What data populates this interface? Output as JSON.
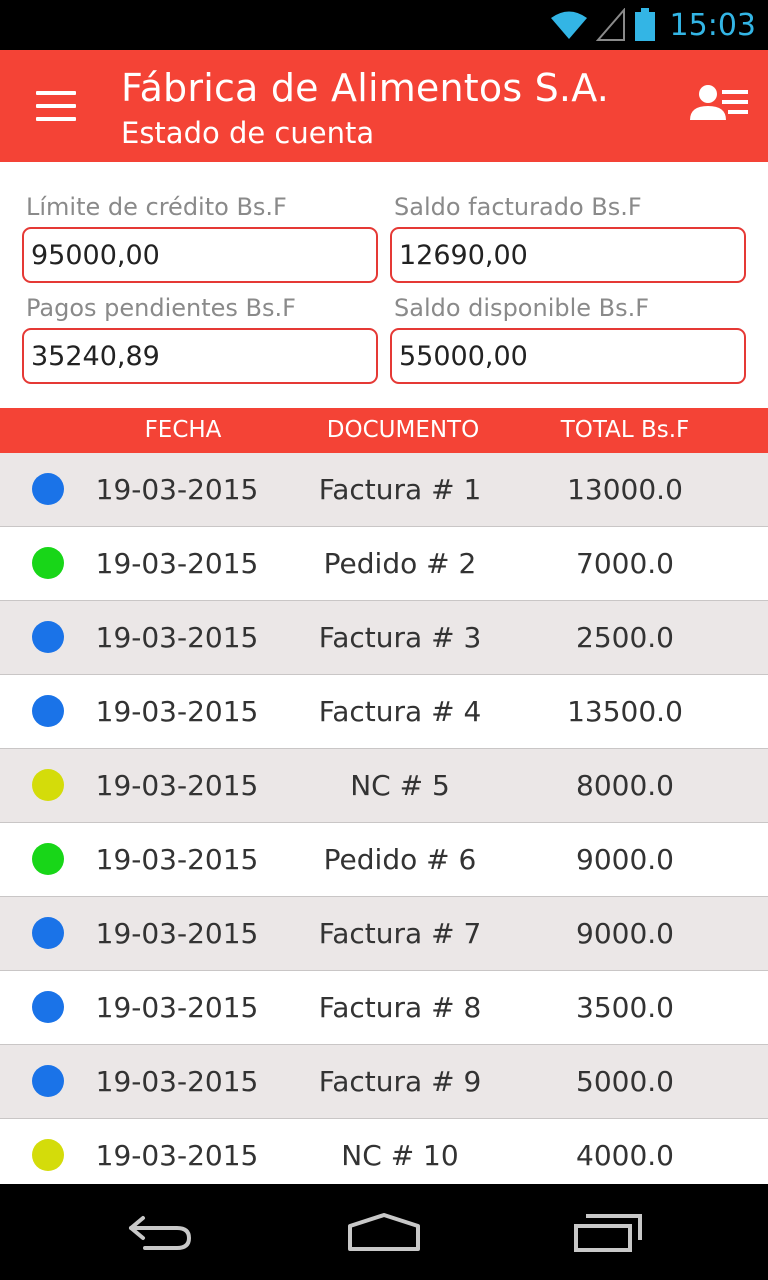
{
  "status_bar": {
    "time": "15:03",
    "icons": [
      "wifi-icon",
      "signal-icon",
      "battery-icon"
    ]
  },
  "app_bar": {
    "title": "Fábrica de Alimentos S.A.",
    "subtitle": "Estado de cuenta",
    "icons": [
      "menu-icon",
      "user-list-icon"
    ]
  },
  "summary": {
    "credit_limit": {
      "label": "Límite de crédito Bs.F",
      "value": "95000,00"
    },
    "billed_balance": {
      "label": "Saldo facturado Bs.F",
      "value": "12690,00"
    },
    "pending_payments": {
      "label": "Pagos pendientes Bs.F",
      "value": "35240,89"
    },
    "available_balance": {
      "label": "Saldo disponible Bs.F",
      "value": "55000,00"
    }
  },
  "table": {
    "headers": {
      "date": "FECHA",
      "document": "DOCUMENTO",
      "total": "TOTAL Bs.F"
    },
    "rows": [
      {
        "status_color": "#1a73e8",
        "date": "19-03-2015",
        "document": "Factura # 1",
        "total": "13000.0"
      },
      {
        "status_color": "#18d618",
        "date": "19-03-2015",
        "document": "Pedido # 2",
        "total": "7000.0"
      },
      {
        "status_color": "#1a73e8",
        "date": "19-03-2015",
        "document": "Factura # 3",
        "total": "2500.0"
      },
      {
        "status_color": "#1a73e8",
        "date": "19-03-2015",
        "document": "Factura # 4",
        "total": "13500.0"
      },
      {
        "status_color": "#d4dc0a",
        "date": "19-03-2015",
        "document": "NC # 5",
        "total": "8000.0"
      },
      {
        "status_color": "#18d618",
        "date": "19-03-2015",
        "document": "Pedido # 6",
        "total": "9000.0"
      },
      {
        "status_color": "#1a73e8",
        "date": "19-03-2015",
        "document": "Factura # 7",
        "total": "9000.0"
      },
      {
        "status_color": "#1a73e8",
        "date": "19-03-2015",
        "document": "Factura # 8",
        "total": "3500.0"
      },
      {
        "status_color": "#1a73e8",
        "date": "19-03-2015",
        "document": "Factura # 9",
        "total": "5000.0"
      },
      {
        "status_color": "#d4dc0a",
        "date": "19-03-2015",
        "document": "NC # 10",
        "total": "4000.0"
      }
    ]
  },
  "nav_bar": {
    "icons": [
      "back-icon",
      "home-icon",
      "recent-apps-icon"
    ]
  },
  "colors": {
    "accent": "#f44336",
    "field_border": "#e53935",
    "status_time": "#33b5e5"
  }
}
